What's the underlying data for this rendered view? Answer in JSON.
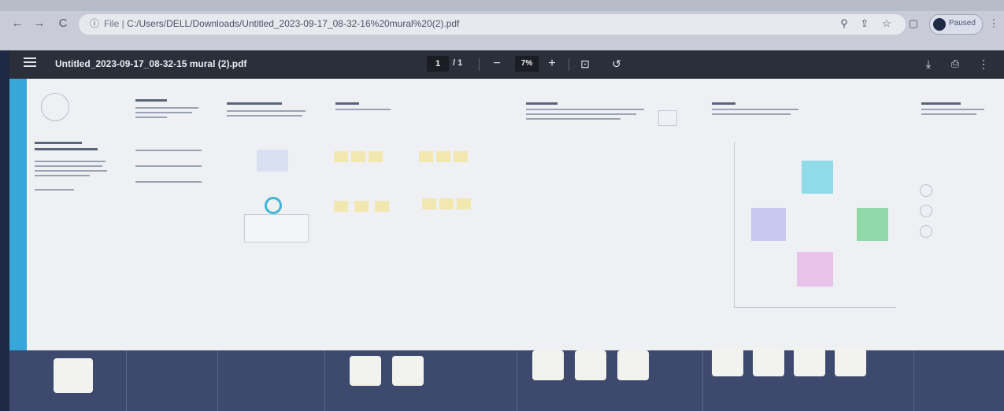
{
  "browser": {
    "url_prefix": "File |",
    "url": "C:/Users/DELL/Downloads/Untitled_2023-09-17_08-32-16%20mural%20(2).pdf",
    "profile_label": "Paused"
  },
  "pdf_toolbar": {
    "title": "Untitled_2023-09-17_08-32-15 mural (2).pdf",
    "page_current": "1",
    "page_total": "/ 1",
    "zoom": "7%",
    "zoom_out_label": "−",
    "zoom_in_label": "+"
  },
  "icons": {
    "back": "arrow-left-icon",
    "forward": "arrow-right-icon",
    "reload": "reload-icon",
    "info": "info-icon",
    "search": "search-icon",
    "share": "share-icon",
    "bookmark": "star-icon",
    "sidepanel": "side-panel-icon",
    "download": "download-icon",
    "print": "print-icon",
    "more": "more-icon",
    "menu": "hamburger-icon",
    "fit": "fit-page-icon",
    "rotate": "rotate-icon"
  },
  "colors": {
    "accent": "#37a6d8",
    "toolbar_bg": "#2b2f3a",
    "bottom_band": "#3e4a6d",
    "sticky_yellow": "#f3e7b0",
    "sticky_cyan": "#8fdbe8",
    "sticky_purple": "#c9c8ef",
    "sticky_green": "#8fd9a8",
    "sticky_pink": "#e9c2ea"
  }
}
